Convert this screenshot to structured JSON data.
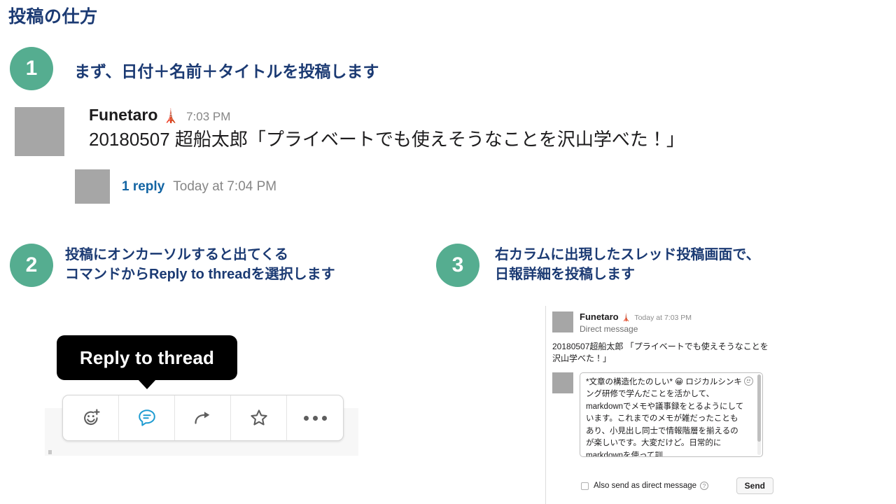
{
  "page": {
    "title": "投稿の仕方",
    "title_color": "#1b3a73",
    "accent_green": "#55ad90",
    "slack_blue": "#1264a3"
  },
  "steps": [
    {
      "number": "1",
      "line1": "まず、日付＋名前＋タイトルを投稿します",
      "line2": ""
    },
    {
      "number": "2",
      "line1": "投稿にオンカーソルすると出てくる",
      "line2": "コマンドからReply to threadを選択します"
    },
    {
      "number": "3",
      "line1": "右カラムに出現したスレッド投稿画面で、",
      "line2": "日報詳細を投稿します"
    }
  ],
  "slack_message": {
    "author": "Funetaro",
    "author_emoji": "🗼",
    "timestamp": "7:03 PM",
    "text": "20180507 超船太郎「プライベートでも使えそうなことを沢山学べた！」",
    "thread": {
      "reply_count": "1 reply",
      "reply_time": "Today at 7:04 PM"
    }
  },
  "hover_toolbar": {
    "tooltip": "Reply to thread",
    "buttons": [
      {
        "name": "add-reaction",
        "icon": "emoji-plus-icon"
      },
      {
        "name": "reply-in-thread",
        "icon": "thread-comment-icon"
      },
      {
        "name": "share-message",
        "icon": "share-arrow-icon"
      },
      {
        "name": "star-message",
        "icon": "star-icon"
      },
      {
        "name": "more-actions",
        "icon": "ellipsis-icon"
      }
    ]
  },
  "thread_panel": {
    "author": "Funetaro",
    "author_emoji": "🗼",
    "timestamp": "Today at 7:03 PM",
    "subtitle": "Direct message",
    "quoted_message": "20180507超船太郎 「プライベートでも使えそうなことを沢山学べた！」",
    "compose": {
      "value": "*文章の構造化たのしい* 😀\nロジカルシンキング研修で学んだことを活かして、markdownでメモや議事録をとるようにしています。これまでのメモが雑だったこともあり、小見出し同士で情報階層を揃えるのが楽しいです。大変だけど。日常的にmarkdownを使って訓",
      "emoji_button": "emoji-picker-icon"
    },
    "footer": {
      "checkbox_label": "Also send as direct message",
      "help_glyph": "?",
      "send_label": "Send",
      "checked": false
    }
  }
}
